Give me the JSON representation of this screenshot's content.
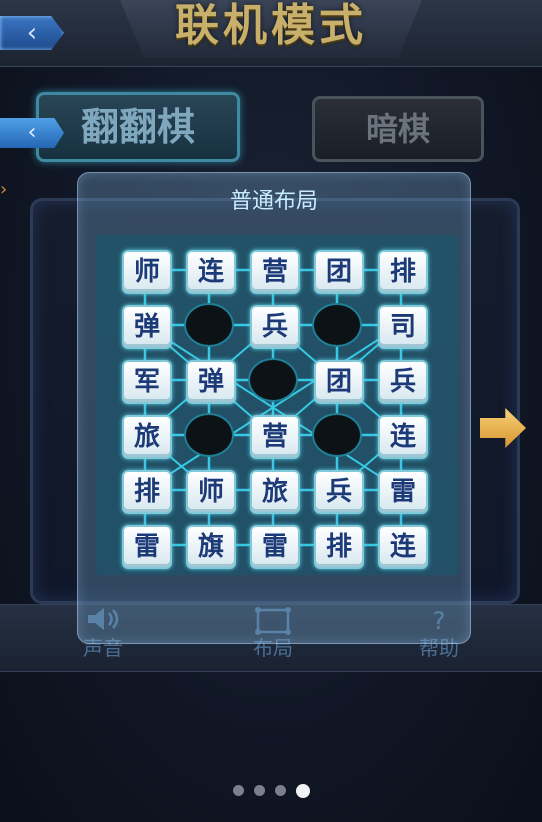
{
  "header": {
    "title": "联机模式",
    "back_icon": "‹"
  },
  "mode_tabs": {
    "active_label": "翻翻棋",
    "inactive_label": "暗棋",
    "tab_arrow_icon": "‹"
  },
  "layout_panel": {
    "title": "普通布局"
  },
  "board": {
    "rows": [
      [
        "师",
        "连",
        "营",
        "团",
        "排"
      ],
      [
        "弹",
        "",
        "兵",
        "",
        "司"
      ],
      [
        "军",
        "弹",
        "",
        "团",
        "兵"
      ],
      [
        "旅",
        "",
        "营",
        "",
        "连"
      ],
      [
        "排",
        "师",
        "旅",
        "兵",
        "雷"
      ],
      [
        "雷",
        "旗",
        "雷",
        "排",
        "连"
      ]
    ]
  },
  "bottom_bar": {
    "sound": {
      "label": "声音",
      "icon": "speaker-icon"
    },
    "layout": {
      "label": "布局",
      "icon": "layout-frame-icon"
    },
    "help": {
      "label": "帮助",
      "icon": "?"
    }
  },
  "pagination": {
    "total": 4,
    "active_index": 3
  },
  "colors": {
    "accent": "#3f8aa1",
    "piece_text": "#1d3a78",
    "title_gold": "#c9b06a",
    "arrow": "#d8942e"
  }
}
